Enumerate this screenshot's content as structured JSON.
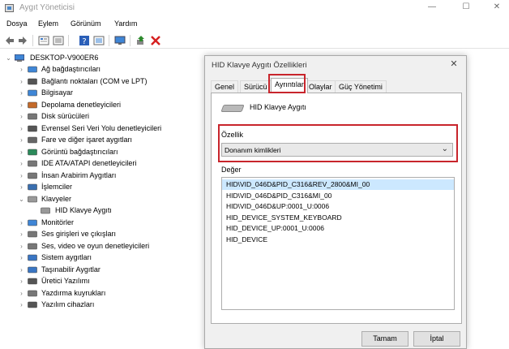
{
  "window": {
    "title": "Aygıt Yöneticisi",
    "controls": [
      "—",
      "☐",
      "✕"
    ]
  },
  "menu": [
    "Dosya",
    "Eylem",
    "Görünüm",
    "Yardım"
  ],
  "toolbar": {
    "icons": [
      "back-arrow-icon",
      "forward-arrow-icon",
      "properties-icon",
      "list-icon",
      "help-icon",
      "view-icon",
      "monitor-icon",
      "update-driver-icon",
      "uninstall-icon"
    ],
    "colors": {
      "uninstall": "#d62020",
      "update": "#2d8a2d",
      "help": "#2b5fb8"
    }
  },
  "tree": {
    "root": "DESKTOP-V900ER6",
    "items": [
      {
        "label": "Ağ bağdaştırıcıları",
        "expanded": false,
        "icon": "network-icon"
      },
      {
        "label": "Bağlantı noktaları (COM ve LPT)",
        "expanded": false,
        "icon": "port-icon"
      },
      {
        "label": "Bilgisayar",
        "expanded": false,
        "icon": "computer-icon"
      },
      {
        "label": "Depolama denetleyicileri",
        "expanded": false,
        "icon": "storage-icon"
      },
      {
        "label": "Disk sürücüleri",
        "expanded": false,
        "icon": "disk-icon"
      },
      {
        "label": "Evrensel Seri Veri Yolu denetleyicileri",
        "expanded": false,
        "icon": "usb-icon"
      },
      {
        "label": "Fare ve diğer işaret aygıtları",
        "expanded": false,
        "icon": "mouse-icon"
      },
      {
        "label": "Görüntü bağdaştırıcıları",
        "expanded": false,
        "icon": "display-adapter-icon"
      },
      {
        "label": "IDE ATA/ATAPI denetleyicileri",
        "expanded": false,
        "icon": "ide-icon"
      },
      {
        "label": "İnsan Arabirim Aygıtları",
        "expanded": false,
        "icon": "hid-icon"
      },
      {
        "label": "İşlemciler",
        "expanded": false,
        "icon": "processor-icon"
      },
      {
        "label": "Klavyeler",
        "expanded": true,
        "icon": "keyboard-icon"
      },
      {
        "label": "HID Klavye Aygıtı",
        "child": true,
        "icon": "keyboard-icon"
      },
      {
        "label": "Monitörler",
        "expanded": false,
        "icon": "monitor-icon"
      },
      {
        "label": "Ses girişleri ve çıkışları",
        "expanded": false,
        "icon": "speaker-icon"
      },
      {
        "label": "Ses, video ve oyun denetleyicileri",
        "expanded": false,
        "icon": "sound-icon"
      },
      {
        "label": "Sistem aygıtları",
        "expanded": false,
        "icon": "system-icon"
      },
      {
        "label": "Taşınabilir Aygıtlar",
        "expanded": false,
        "icon": "portable-icon"
      },
      {
        "label": "Üretici Yazılımı",
        "expanded": false,
        "icon": "firmware-icon"
      },
      {
        "label": "Yazdırma kuyrukları",
        "expanded": false,
        "icon": "printer-icon"
      },
      {
        "label": "Yazılım cihazları",
        "expanded": false,
        "icon": "software-icon"
      }
    ]
  },
  "dialog": {
    "title": "HID Klavye Aygıtı Özellikleri",
    "close": "✕",
    "tabs": [
      "Genel",
      "Sürücü",
      "Ayrıntılar",
      "Olaylar",
      "Güç Yönetimi"
    ],
    "active_tab": "Ayrıntılar",
    "device_name": "HID Klavye Aygıtı",
    "property_label": "Özellik",
    "property_value": "Donanım kimlikleri",
    "value_label": "Değer",
    "values": [
      "HID\\VID_046D&PID_C316&REV_2800&MI_00",
      "HID\\VID_046D&PID_C316&MI_00",
      "HID\\VID_046D&UP:0001_U:0006",
      "HID_DEVICE_SYSTEM_KEYBOARD",
      "HID_DEVICE_UP:0001_U:0006",
      "HID_DEVICE"
    ],
    "selected_value_index": 0,
    "ok_label": "Tamam",
    "cancel_label": "İptal",
    "highlight_color": "#c8252c"
  }
}
